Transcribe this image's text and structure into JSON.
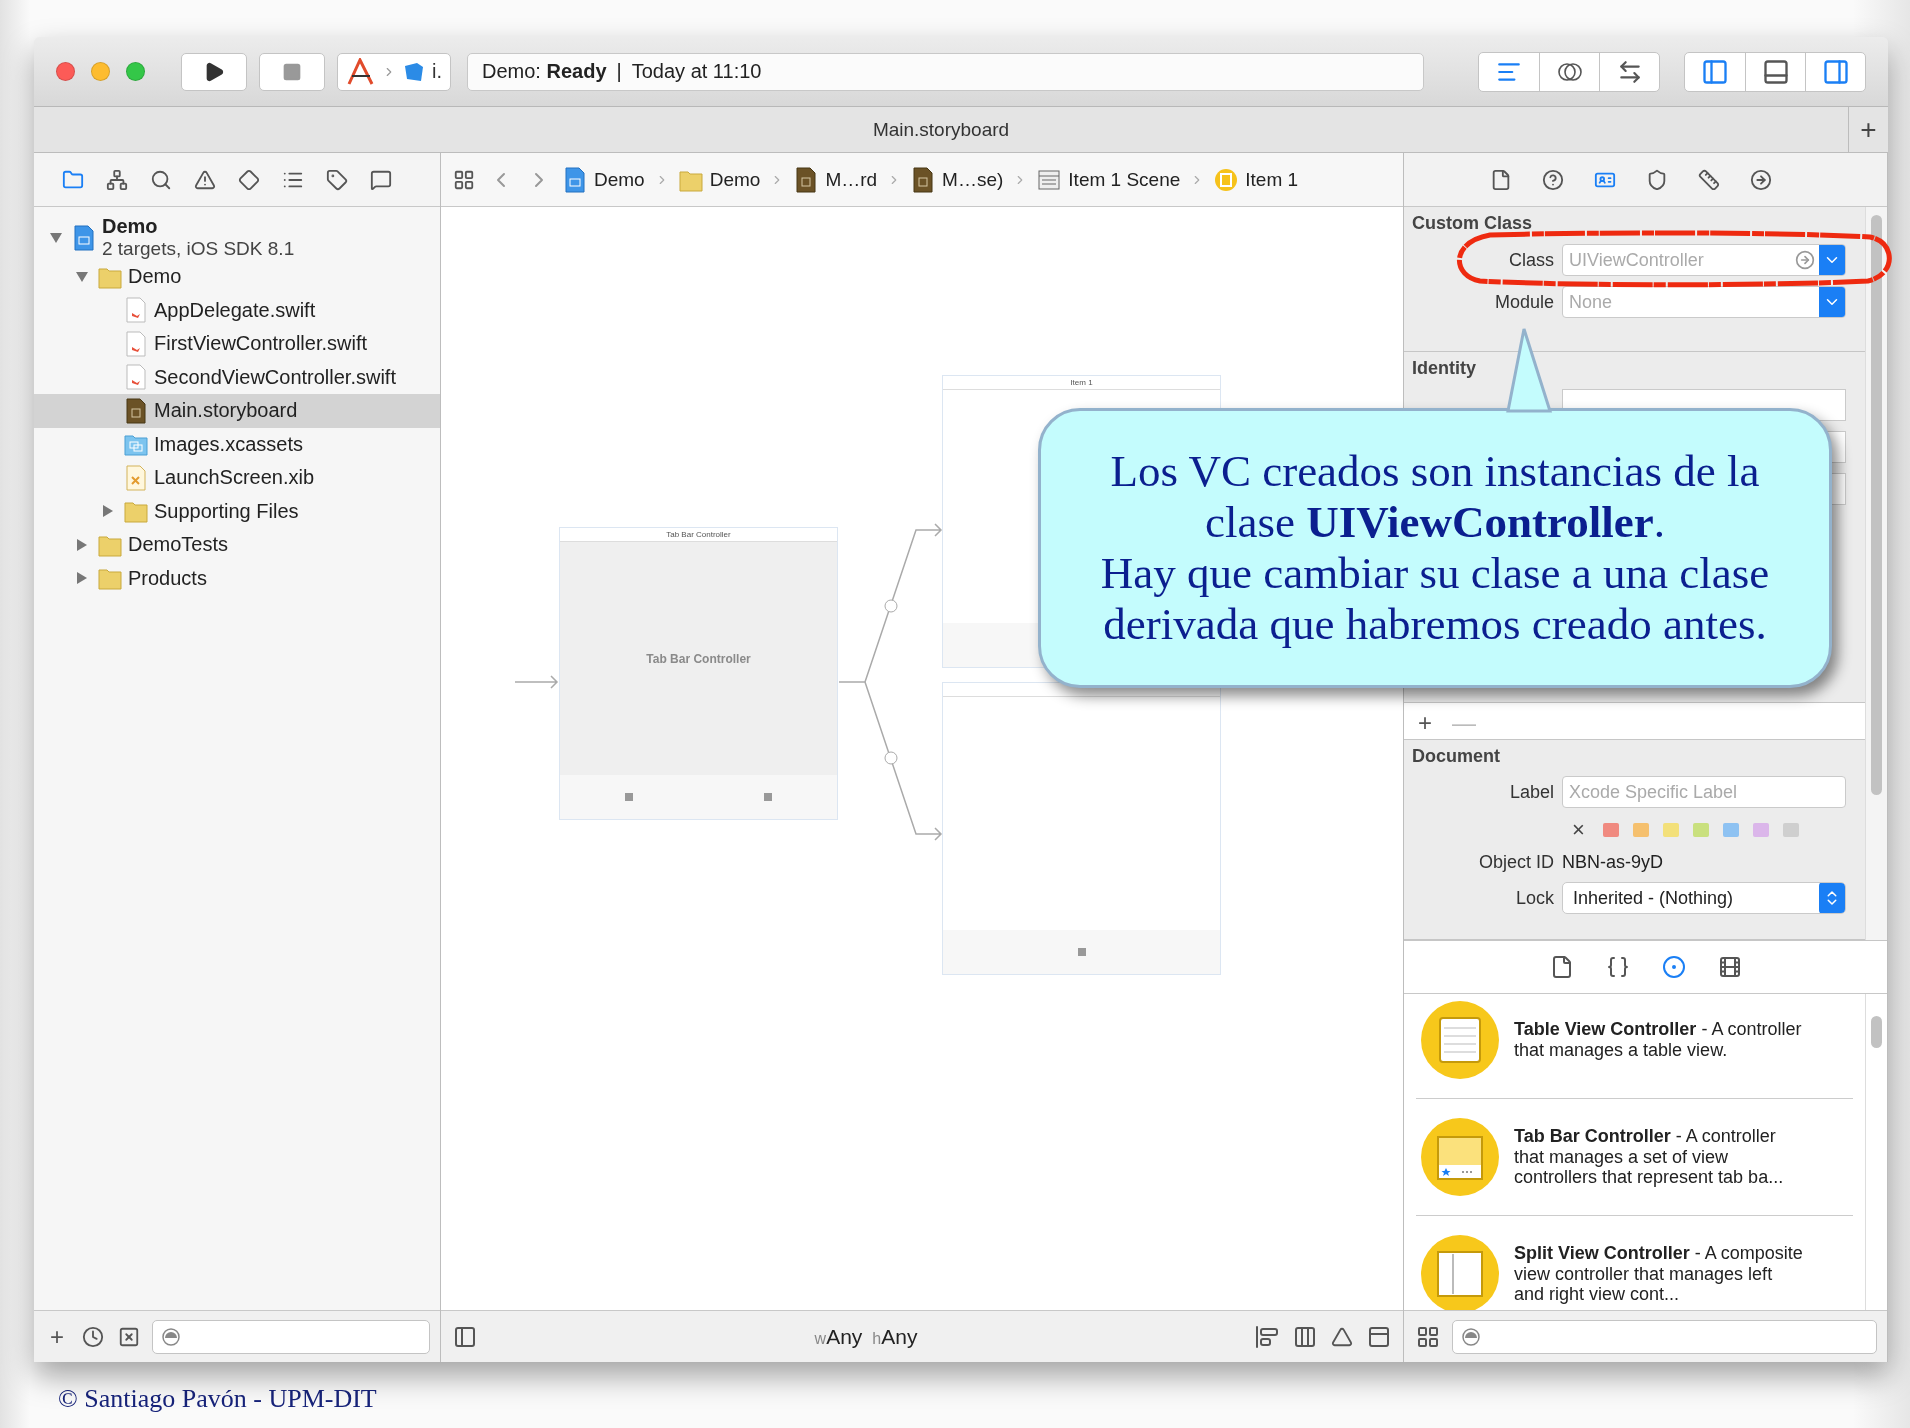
{
  "toolbar": {
    "scheme": "i.",
    "status_project": "Demo:",
    "status_state": "Ready",
    "status_separator": "|",
    "status_time": "Today at 11:10",
    "editor_modes": [
      {
        "kind": "standard",
        "selected": true
      },
      {
        "kind": "assistant",
        "selected": false
      },
      {
        "kind": "version",
        "selected": false
      }
    ],
    "panels": [
      {
        "kind": "navigator",
        "on": true
      },
      {
        "kind": "debug",
        "on": false
      },
      {
        "kind": "utilities",
        "on": true
      }
    ]
  },
  "tab_bar": {
    "title": "Main.storyboard",
    "add": "+"
  },
  "navigator": {
    "tabs": [
      {
        "kind": "project",
        "selected": true
      },
      {
        "kind": "symbols",
        "selected": false
      },
      {
        "kind": "find",
        "selected": false
      },
      {
        "kind": "issues",
        "selected": false
      },
      {
        "kind": "tests",
        "selected": false
      },
      {
        "kind": "debug",
        "selected": false
      },
      {
        "kind": "breakpoints",
        "selected": false
      },
      {
        "kind": "reports",
        "selected": false
      }
    ],
    "tree": [
      {
        "kind": "project",
        "label": "Demo",
        "subtitle": "2 targets, iOS SDK 8.1",
        "expanded": true,
        "selected": false,
        "children": [
          {
            "kind": "folder",
            "label": "Demo",
            "expanded": true,
            "selected": false,
            "children": [
              {
                "kind": "swift",
                "label": "AppDelegate.swift",
                "selected": false
              },
              {
                "kind": "swift",
                "label": "FirstViewController.swift",
                "selected": false
              },
              {
                "kind": "swift",
                "label": "SecondViewController.swift",
                "selected": false
              },
              {
                "kind": "storyboard",
                "label": "Main.storyboard",
                "selected": true
              },
              {
                "kind": "assets",
                "label": "Images.xcassets",
                "selected": false
              },
              {
                "kind": "xib",
                "label": "LaunchScreen.xib",
                "selected": false
              },
              {
                "kind": "folder",
                "label": "Supporting Files",
                "expanded": false,
                "selected": false
              }
            ]
          },
          {
            "kind": "folder",
            "label": "DemoTests",
            "expanded": false,
            "selected": false
          },
          {
            "kind": "folder",
            "label": "Products",
            "expanded": false,
            "selected": false
          }
        ]
      }
    ],
    "add": "+"
  },
  "jump_bar": {
    "crumbs": [
      {
        "kind": "project",
        "label": "Demo"
      },
      {
        "kind": "folder",
        "label": "Demo"
      },
      {
        "kind": "storyboard",
        "label": "M…rd"
      },
      {
        "kind": "storyboard",
        "label": "M…se)"
      },
      {
        "kind": "scene",
        "label": "Item 1 Scene"
      },
      {
        "kind": "controller",
        "label": "Item 1"
      }
    ]
  },
  "canvas": {
    "scenes": [
      {
        "kind": "tab_bar_controller",
        "title": "Tab Bar Controller",
        "label": "Tab Bar Controller"
      },
      {
        "kind": "view_controller",
        "title": "Item 1"
      },
      {
        "kind": "view_controller"
      }
    ],
    "size_class": [
      {
        "prefix": "w",
        "value": "Any"
      },
      {
        "prefix": "h",
        "value": "Any"
      }
    ]
  },
  "inspector": {
    "tabs": [
      {
        "kind": "file",
        "selected": false
      },
      {
        "kind": "help",
        "selected": false
      },
      {
        "kind": "identity",
        "selected": true
      },
      {
        "kind": "attributes",
        "selected": false
      },
      {
        "kind": "size",
        "selected": false
      },
      {
        "kind": "connections",
        "selected": false
      }
    ],
    "custom_class": {
      "title": "Custom Class",
      "class_label": "Class",
      "class_placeholder": "UIViewController",
      "module_label": "Module",
      "module_placeholder": "None"
    },
    "identity": {
      "title": "Identity"
    },
    "attributes_add": "+",
    "attributes_remove": "—",
    "document": {
      "title": "Document",
      "label_label": "Label",
      "label_placeholder": "Xcode Specific Label",
      "clear": "×",
      "colors": [
        {
          "color": "#f08a80"
        },
        {
          "color": "#f5c06e"
        },
        {
          "color": "#f3e07a"
        },
        {
          "color": "#c9e07e"
        },
        {
          "color": "#8ec2f2"
        },
        {
          "color": "#dbb6ea"
        },
        {
          "color": "#cfcfcf"
        }
      ],
      "object_id_label": "Object ID",
      "object_id": "NBN-as-9yD",
      "lock_label": "Lock",
      "lock_value": "Inherited - (Nothing)"
    },
    "library": {
      "tabs": [
        {
          "kind": "file",
          "selected": false
        },
        {
          "kind": "code",
          "selected": false
        },
        {
          "kind": "object",
          "selected": true
        },
        {
          "kind": "media",
          "selected": false
        }
      ],
      "items": [
        {
          "kind": "table",
          "text": "**Table View Controller** - A controller that manages a table view."
        },
        {
          "kind": "tab_bar",
          "text": "**Tab Bar Controller** - A controller that manages a set of view controllers that represent tab ba..."
        },
        {
          "kind": "split",
          "text": "**Split View Controller** - A composite view controller that manages left and right view cont..."
        }
      ]
    }
  },
  "callout": {
    "paragraphs": [
      "Los VC creados son instancias de la clase **UIViewController**.",
      "Hay que cambiar su clase a una clase derivada que habremos creado antes."
    ]
  },
  "footer": "© Santiago Pavón - UPM-DIT"
}
